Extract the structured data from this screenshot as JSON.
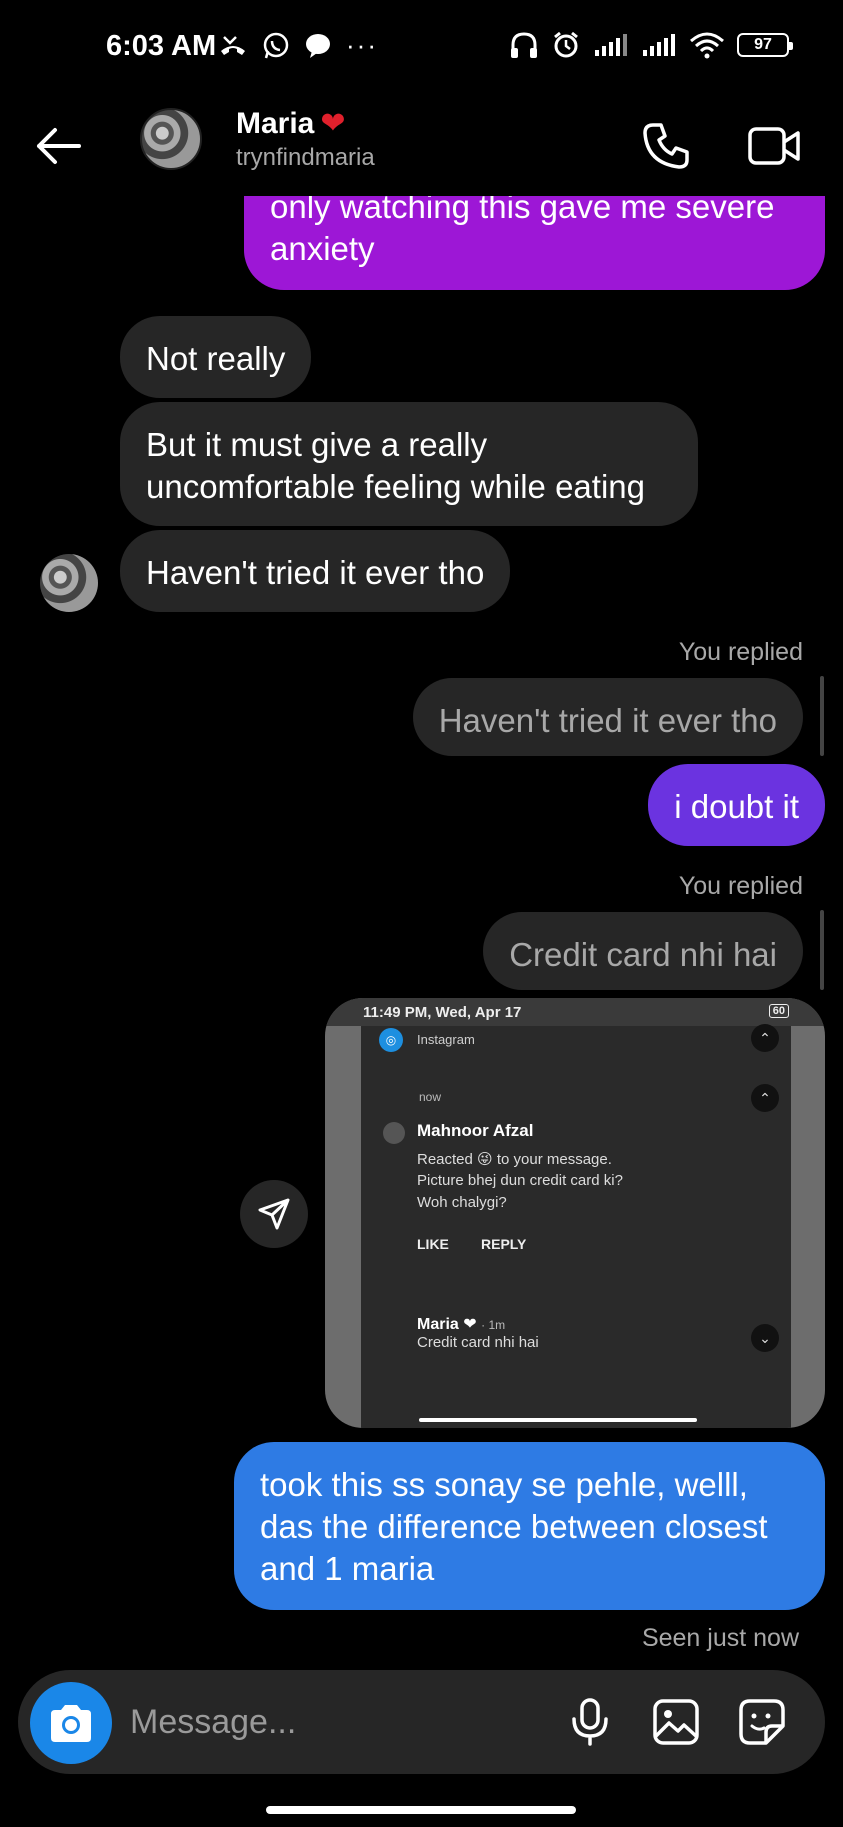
{
  "status_bar": {
    "time": "6:03 AM",
    "battery": "97"
  },
  "header": {
    "name": "Maria",
    "name_emoji": "❤",
    "username": "trynfindmaria"
  },
  "messages": {
    "m1": "only watching this gave me severe anxiety",
    "m2": "Not really",
    "m3": "But it must give a really uncomfortable feeling while eating",
    "m4": "Haven't tried it ever tho",
    "reply1_label": "You replied",
    "reply1_ref": "Haven't tried it ever tho",
    "m5": "i doubt it",
    "reply2_label": "You replied",
    "reply2_ref": "Credit card nhi hai",
    "m6": "took this ss sonay se pehle, welll, das the difference between closest and 1 maria",
    "seen": "Seen just now"
  },
  "screenshot": {
    "time": "11:49 PM, Wed, Apr 17",
    "battery": "60",
    "app": "Instagram",
    "now": "now",
    "sender": "Mahnoor Afzal",
    "line1": "Reacted 😜 to your message.",
    "line2": "Picture bhej dun credit card ki?",
    "line3": "Woh chalygi?",
    "like": "LIKE",
    "reply": "REPLY",
    "maria": "Maria ❤",
    "maria_time": "· 1m",
    "maria_msg": "Credit card nhi hai"
  },
  "composer": {
    "placeholder": "Message..."
  }
}
